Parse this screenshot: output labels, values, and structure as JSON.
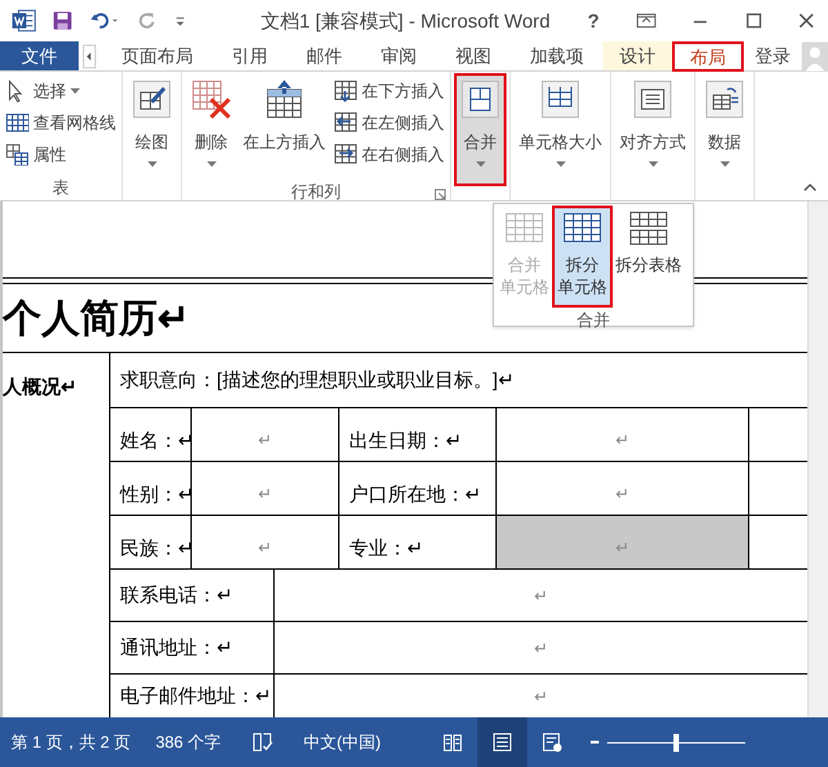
{
  "window": {
    "title": "文档1 [兼容模式] - Microsoft Word",
    "help": "?"
  },
  "tabs": [
    {
      "label": "文件",
      "kind": "file",
      "selected": false,
      "highlighted": false
    },
    {
      "label": "页面布局",
      "kind": "normal",
      "selected": false,
      "highlighted": false
    },
    {
      "label": "引用",
      "kind": "normal",
      "selected": false,
      "highlighted": false
    },
    {
      "label": "邮件",
      "kind": "normal",
      "selected": false,
      "highlighted": false
    },
    {
      "label": "审阅",
      "kind": "normal",
      "selected": false,
      "highlighted": false
    },
    {
      "label": "视图",
      "kind": "normal",
      "selected": false,
      "highlighted": false
    },
    {
      "label": "加载项",
      "kind": "normal",
      "selected": false,
      "highlighted": false
    },
    {
      "label": "设计",
      "kind": "contextual",
      "selected": false,
      "highlighted": false
    },
    {
      "label": "布局",
      "kind": "contextual",
      "selected": true,
      "highlighted": true
    }
  ],
  "account": {
    "label": "登录"
  },
  "ribbon": {
    "groups": [
      {
        "label": "表",
        "buttons": [
          {
            "label": "选择",
            "kind": "small",
            "dropdown": true,
            "pressed": false,
            "highlighted": false
          },
          {
            "label": "查看网格线",
            "kind": "small",
            "dropdown": false,
            "pressed": false,
            "highlighted": false
          },
          {
            "label": "属性",
            "kind": "small",
            "dropdown": false,
            "pressed": false,
            "highlighted": false
          }
        ]
      },
      {
        "buttons": [
          {
            "label": "绘图",
            "kind": "large",
            "dropdown": true,
            "pressed": false,
            "highlighted": false
          }
        ]
      },
      {
        "label": "行和列",
        "launcher": true,
        "buttons": [
          {
            "label": "删除",
            "kind": "large",
            "dropdown": true,
            "pressed": false,
            "highlighted": false
          },
          {
            "label": "在上方插入",
            "kind": "large",
            "dropdown": false,
            "pressed": false,
            "highlighted": false
          },
          {
            "label": "在下方插入",
            "kind": "small",
            "dropdown": false,
            "pressed": false,
            "highlighted": false
          },
          {
            "label": "在左侧插入",
            "kind": "small",
            "dropdown": false,
            "pressed": false,
            "highlighted": false
          },
          {
            "label": "在右侧插入",
            "kind": "small",
            "dropdown": false,
            "pressed": false,
            "highlighted": false
          }
        ]
      },
      {
        "buttons": [
          {
            "label": "合并",
            "kind": "large",
            "dropdown": true,
            "pressed": true,
            "highlighted": true
          }
        ]
      },
      {
        "buttons": [
          {
            "label": "单元格大小",
            "kind": "large",
            "dropdown": true,
            "pressed": false,
            "highlighted": false
          }
        ]
      },
      {
        "buttons": [
          {
            "label": "对齐方式",
            "kind": "large",
            "dropdown": true,
            "pressed": false,
            "highlighted": false
          }
        ]
      },
      {
        "buttons": [
          {
            "label": "数据",
            "kind": "large",
            "dropdown": true,
            "pressed": false,
            "highlighted": false
          }
        ]
      }
    ]
  },
  "merge_menu": {
    "label": "合并",
    "items": [
      {
        "lines": [
          "合并",
          "单元格"
        ],
        "disabled": true,
        "selected": false,
        "highlighted": false
      },
      {
        "lines": [
          "拆分",
          "单元格"
        ],
        "disabled": false,
        "selected": true,
        "highlighted": true
      },
      {
        "lines": [
          "拆分表格"
        ],
        "disabled": false,
        "selected": false,
        "highlighted": false
      }
    ]
  },
  "document": {
    "title": "个人简历↵",
    "section_label": "人概况↵",
    "objective": "求职意向：[描述您的理想职业或职业目标。]↵",
    "info_rows": [
      {
        "cells": [
          {
            "text": "姓名：↵",
            "kind": "label",
            "shaded": false
          },
          {
            "text": "↵",
            "kind": "value",
            "shaded": false
          },
          {
            "text": "出生日期：↵",
            "kind": "label",
            "shaded": false
          },
          {
            "text": "↵",
            "kind": "value",
            "shaded": false
          }
        ]
      },
      {
        "cells": [
          {
            "text": "性别：↵",
            "kind": "label",
            "shaded": false
          },
          {
            "text": "↵",
            "kind": "value",
            "shaded": false
          },
          {
            "text": "户口所在地：↵",
            "kind": "label",
            "shaded": false
          },
          {
            "text": "↵",
            "kind": "value",
            "shaded": false
          }
        ]
      },
      {
        "cells": [
          {
            "text": "民族：↵",
            "kind": "label",
            "shaded": false
          },
          {
            "text": "↵",
            "kind": "value",
            "shaded": false
          },
          {
            "text": "专业：↵",
            "kind": "label",
            "shaded": false
          },
          {
            "text": "↵",
            "kind": "value",
            "shaded": true
          }
        ]
      }
    ],
    "contact_rows": [
      {
        "label": "联系电话：↵",
        "value": "↵"
      },
      {
        "label": "通讯地址：↵",
        "value": "↵"
      },
      {
        "label": "电子邮件地址：↵",
        "value": "↵"
      }
    ]
  },
  "status_bar": {
    "page": "第 1 页，共 2 页",
    "words": "386 个字",
    "language": "中文(中国)",
    "views": [
      {
        "selected": false
      },
      {
        "selected": true
      },
      {
        "selected": false
      }
    ],
    "zoom": {
      "level": 0.5
    }
  }
}
